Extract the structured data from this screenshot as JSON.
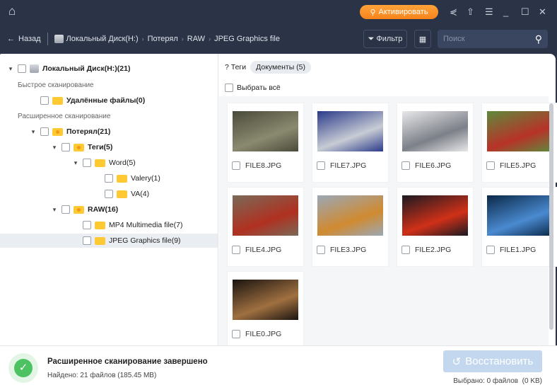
{
  "topbar": {
    "activate_label": "Активировать"
  },
  "nav": {
    "back_label": "Назад",
    "breadcrumbs": [
      "Локальный Диск(H:)",
      "Потерял",
      "RAW",
      "JPEG Graphics file"
    ],
    "filter_label": "Фильтр",
    "search_placeholder": "Поиск"
  },
  "tree": {
    "root": "Локальный Диск(H:)(21)",
    "quick_scan": "Быстрое сканирование",
    "deleted": "Удалённые файлы(0)",
    "deep_scan": "Расширенное сканирование",
    "lost": "Потерял(21)",
    "tags": "Теги(5)",
    "word": "Word(5)",
    "valery": "Valery(1)",
    "va": "VA(4)",
    "raw": "RAW(16)",
    "mp4": "MP4 Multimedia file(7)",
    "jpeg": "JPEG Graphics file(9)"
  },
  "main": {
    "tab_tags": "Теги",
    "tab_docs": "Документы (5)",
    "select_all": "Выбрать всё",
    "files": [
      {
        "name": "FILE8.JPG",
        "c1": "#4a4a3a",
        "c2": "#8a8a70"
      },
      {
        "name": "FILE7.JPG",
        "c1": "#2a3a8a",
        "c2": "#c8ccd4"
      },
      {
        "name": "FILE6.JPG",
        "c1": "#e8e8ea",
        "c2": "#7c8088"
      },
      {
        "name": "FILE5.JPG",
        "c1": "#5e8a3c",
        "c2": "#b83228"
      },
      {
        "name": "FILE4.JPG",
        "c1": "#7a6a58",
        "c2": "#b03020"
      },
      {
        "name": "FILE3.JPG",
        "c1": "#9aa8b8",
        "c2": "#d08a30"
      },
      {
        "name": "FILE2.JPG",
        "c1": "#1a1a22",
        "c2": "#d03018"
      },
      {
        "name": "FILE1.JPG",
        "c1": "#0a2848",
        "c2": "#4a8ad0"
      },
      {
        "name": "FILE0.JPG",
        "c1": "#1a1410",
        "c2": "#a07040"
      }
    ]
  },
  "footer": {
    "status_title": "Расширенное сканирование завершено",
    "found": "Найдено: 21 файлов (185.45 MB)",
    "restore_label": "Восстановить",
    "selected": "Выбрано: 0 файлов  (0 KB)"
  }
}
